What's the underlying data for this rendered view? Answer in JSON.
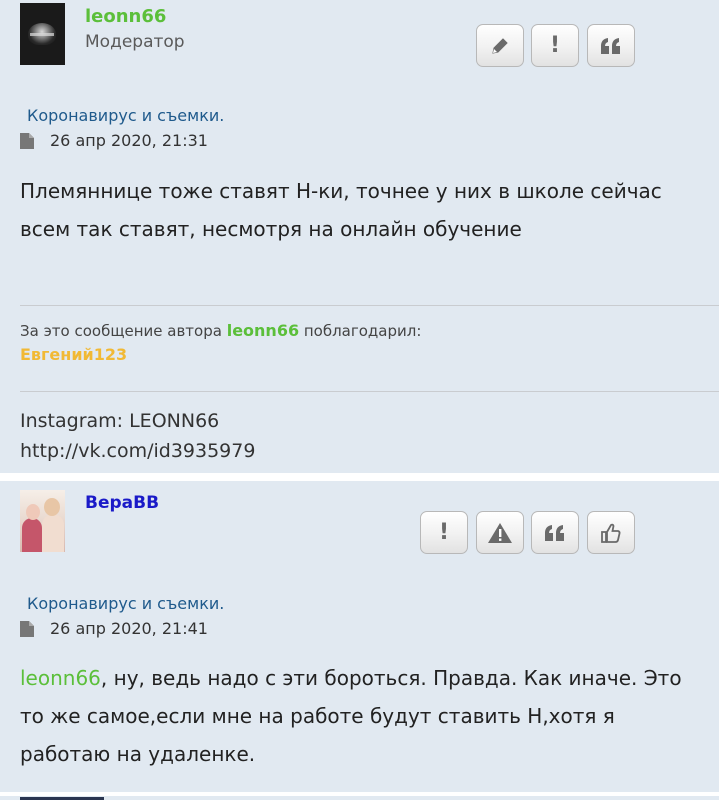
{
  "posts": [
    {
      "username": "leonn66",
      "rank": "Модератор",
      "topic": "Коронавирус и съемки.",
      "date": "26 апр 2020, 21:31",
      "content": "Племяннице тоже ставят Н-ки, точнее у них в школе сейчас всем так ставят, несмотря на онлайн обучение",
      "thanks_prefix": "За это сообщение автора",
      "thanks_user": "leonn66",
      "thanks_suffix": "поблагодарил:",
      "thanker": "Евгений123",
      "signature_line1": "Instagram: LEONN66",
      "signature_line2": "http://vk.com/id3935979",
      "buttons": [
        "edit-icon",
        "report-icon",
        "quote-icon"
      ]
    },
    {
      "username": "ВераВВ",
      "rank": "",
      "topic": "Коронавирус и съемки.",
      "date": "26 апр 2020, 21:41",
      "mention": "leonn66",
      "content_rest": ", ну, ведь надо с эти бороться. Правда. Как иначе. Это то же самое,если мне на работе будут ставить Н,хотя я работаю на удаленке.",
      "buttons": [
        "report-icon",
        "warning-icon",
        "quote-icon",
        "like-icon"
      ]
    }
  ],
  "colors": {
    "post_bg": "#e1e9f1",
    "moderator_name": "#5bbf3a",
    "user_name": "#1a1ac8",
    "topic_link": "#1f5a8c",
    "thanker": "#f1b935"
  }
}
